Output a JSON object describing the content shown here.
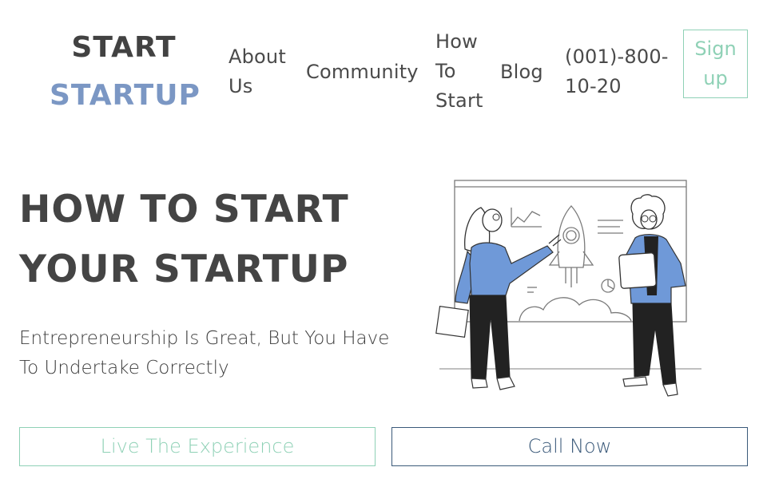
{
  "logo": {
    "line1": "START",
    "line2": "STARTUP"
  },
  "nav": {
    "about": "About Us",
    "community": "Community",
    "how_to_start": "How To Start",
    "blog": "Blog",
    "phone": "(001)-800-10-20",
    "signup": "Sign up"
  },
  "hero": {
    "title": "HOW TO START YOUR STARTUP",
    "subtitle": "Entrepreneurship Is Great, But You Have To Undertake Correctly"
  },
  "buttons": {
    "live": "Live The Experience",
    "call": "Call Now"
  },
  "colors": {
    "accent_green": "#8fd1b6",
    "brand_blue": "#7b97c4",
    "call_border": "#3b5a7a",
    "text_dark": "#444444"
  },
  "illustration": {
    "icon": "startup-presentation-illustration"
  }
}
